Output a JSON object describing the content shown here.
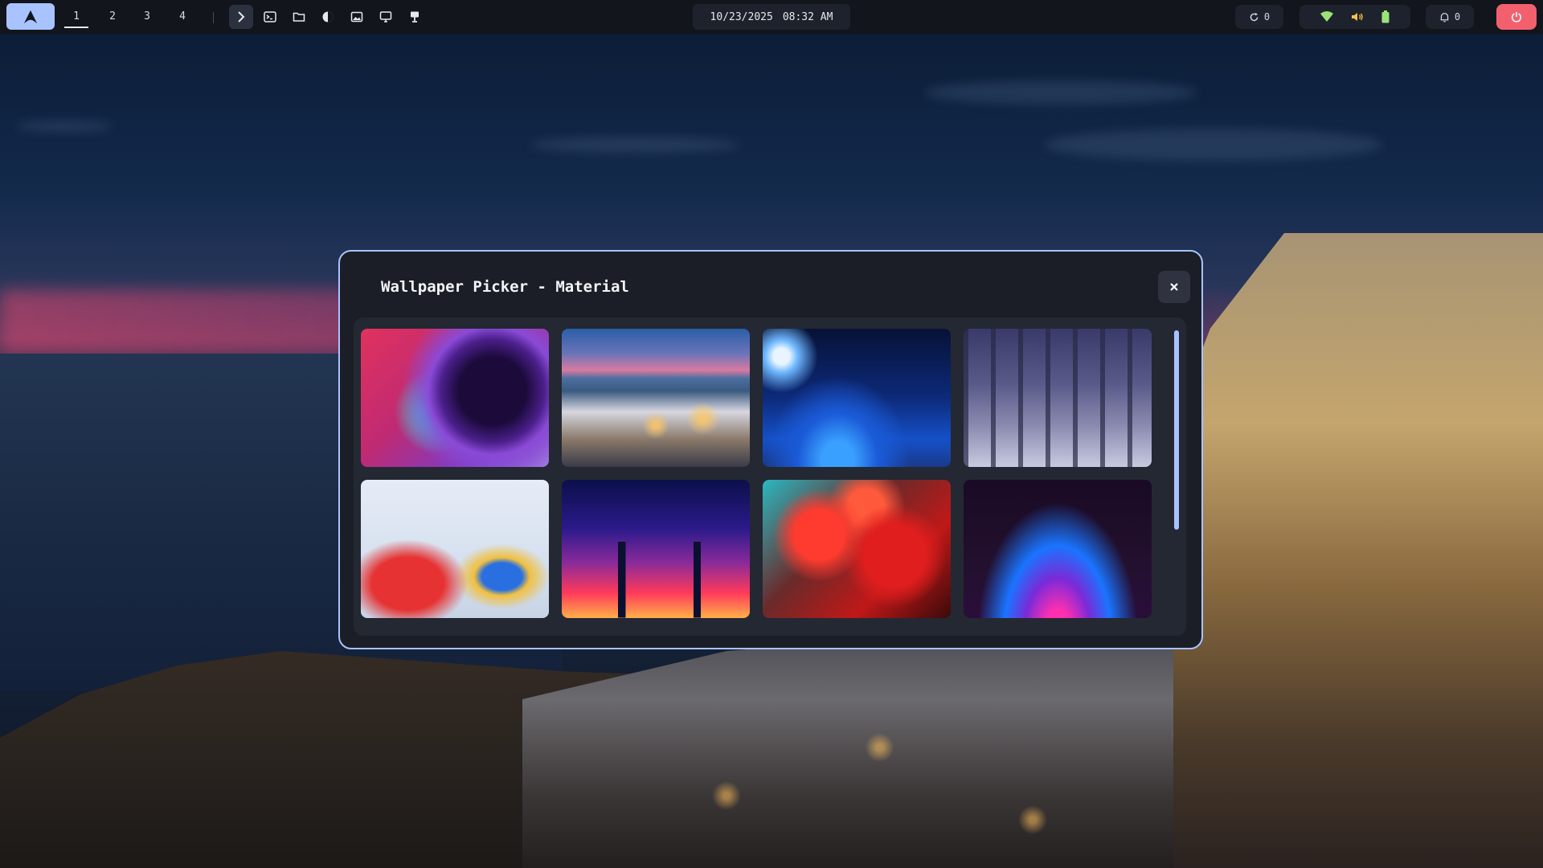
{
  "topbar": {
    "workspaces": [
      "1",
      "2",
      "3",
      "4"
    ],
    "active_workspace": "1",
    "launchers": [
      {
        "icon": "chevron-right-icon"
      },
      {
        "icon": "terminal-icon"
      },
      {
        "icon": "folder-icon"
      },
      {
        "icon": "theme-toggle-icon"
      },
      {
        "icon": "image-icon"
      },
      {
        "icon": "monitor-icon"
      },
      {
        "icon": "display-stand-icon"
      }
    ],
    "date": "10/23/2025",
    "time": "08:32 AM",
    "updates_count": "0",
    "notifications_count": "0",
    "status_icons": [
      "wifi-icon",
      "volume-icon",
      "battery-icon"
    ],
    "accent_color": "#a9c3ff",
    "power_color": "#f2606e"
  },
  "dialog": {
    "title": "Wallpaper Picker - Material",
    "close_label": "×",
    "wallpapers": [
      {
        "name": "nebula",
        "style": "t-nebula"
      },
      {
        "name": "santorini-oia",
        "style": "t-oia"
      },
      {
        "name": "space-comet",
        "style": "t-space"
      },
      {
        "name": "snowy-forest",
        "style": "t-forest"
      },
      {
        "name": "airplane-tails",
        "style": "t-planes"
      },
      {
        "name": "neon-city",
        "style": "t-city"
      },
      {
        "name": "red-leaves",
        "style": "t-leaves"
      },
      {
        "name": "dark-gradient",
        "style": "t-gradient"
      }
    ]
  }
}
